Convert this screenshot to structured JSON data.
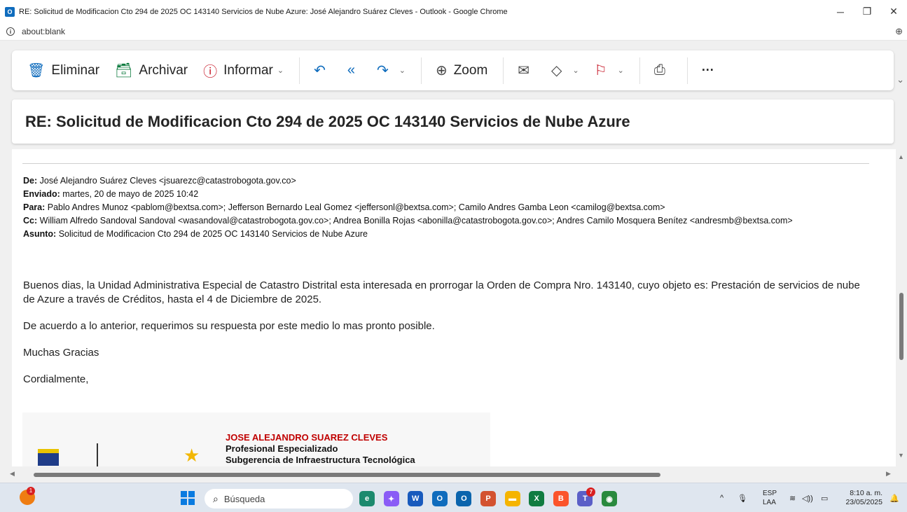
{
  "window": {
    "title": "RE: Solicitud de Modificacion Cto 294 de 2025 OC 143140 Servicios de Nube Azure: José Alejandro Suárez Cleves - Outlook - Google Chrome",
    "app_icon_letter": "O",
    "controls": {
      "minimize": "─",
      "restore": "❐",
      "close": "✕"
    }
  },
  "address_bar": {
    "info_icon": "i",
    "url": "about:blank",
    "zoom_icon": "⊕"
  },
  "toolbar": {
    "delete_icon": "🗑",
    "delete_label": "Eliminar",
    "archive_icon": "🗃",
    "archive_label": "Archivar",
    "report_icon": "ⓘ",
    "report_label": "Informar",
    "reply_icon": "↶",
    "reply_all_icon": "«",
    "forward_icon": "↷",
    "zoom_icon": "⊕",
    "zoom_label": "Zoom",
    "read_icon": "✉",
    "tag_icon": "◇",
    "flag_icon": "⚐",
    "print_icon": "⎙",
    "more_label": "···",
    "chevron": "⌄"
  },
  "email": {
    "subject": "RE: Solicitud de Modificacion Cto 294 de 2025 OC 143140 Servicios de Nube Azure",
    "headers": {
      "from_label": "De:",
      "from": "José Alejandro Suárez Cleves <jsuarezc@catastrobogota.gov.co>",
      "sent_label": "Enviado:",
      "sent": "martes, 20 de mayo de 2025 10:42",
      "to_label": "Para:",
      "to": "Pablo Andres Munoz <pablom@bextsa.com>; Jefferson Bernardo Leal Gomez <jeffersonl@bextsa.com>; Camilo Andres Gamba Leon <camilog@bextsa.com>",
      "cc_label": "Cc:",
      "cc": "William Alfredo Sandoval Sandoval <wasandoval@catastrobogota.gov.co>; Andrea Bonilla Rojas <abonilla@catastrobogota.gov.co>; Andres Camilo Mosquera Benítez <andresmb@bextsa.com>",
      "subject_label": "Asunto:",
      "subject": "Solicitud de Modificacion Cto 294 de 2025 OC 143140 Servicios de Nube Azure"
    },
    "body": {
      "p1": "Buenos dias, la Unidad Administrativa Especial de Catastro Distrital esta interesada en prorrogar la Orden de Compra Nro. 143140, cuyo objeto es: Prestación de servicios de nube de Azure a través de Créditos, hasta el 4 de Diciembre de 2025.",
      "p2": "De acuerdo a lo anterior, requerimos su respuesta por este medio lo mas pronto posible.",
      "p3": "Muchas Gracias",
      "p4": "Cordialmente,"
    },
    "signature": {
      "name": "JOSE ALEJANDRO SUAREZ CLEVES",
      "role": "Profesional Especializado",
      "department": "Subgerencia de Infraestructura Tecnológica"
    }
  },
  "taskbar": {
    "weather_badge": "1",
    "search_placeholder": "Búsqueda",
    "search_icon": "⌕",
    "apps": [
      {
        "name": "edge",
        "label": "e",
        "color": "#1c8a6e"
      },
      {
        "name": "copilot",
        "label": "✦",
        "color": "#8a5cf6"
      },
      {
        "name": "word",
        "label": "W",
        "color": "#185abd"
      },
      {
        "name": "outlook-new",
        "label": "O",
        "color": "#0f6cbd"
      },
      {
        "name": "outlook",
        "label": "O",
        "color": "#0a64ad"
      },
      {
        "name": "powerpoint",
        "label": "P",
        "color": "#d35230"
      },
      {
        "name": "file-explorer",
        "label": "▬",
        "color": "#f5b400"
      },
      {
        "name": "excel",
        "label": "X",
        "color": "#107c41"
      },
      {
        "name": "brave",
        "label": "B",
        "color": "#fb542b"
      },
      {
        "name": "teams",
        "label": "T",
        "color": "#5b5fc7"
      },
      {
        "name": "chrome",
        "label": "◉",
        "color": "#2a8a3e"
      }
    ],
    "teams_badge": "7",
    "tray": {
      "chevron": "^",
      "mic_icon": "🎙",
      "lang_1": "ESP",
      "lang_2": "LAA",
      "wifi_icon": "≋",
      "volume_icon": "◁))",
      "battery_icon": "▭",
      "time": "8:10 a. m.",
      "date": "23/05/2025",
      "notification_icon": "🔔"
    }
  }
}
